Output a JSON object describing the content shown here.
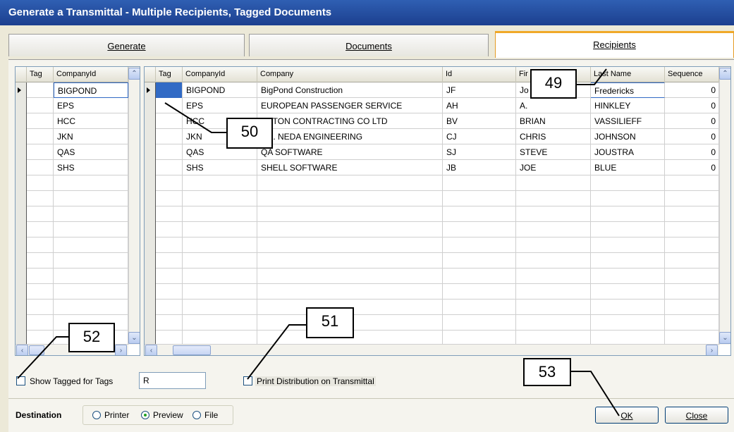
{
  "window": {
    "title": "Generate a Transmittal - Multiple Recipients, Tagged Documents"
  },
  "tabs": [
    {
      "label": "Generate"
    },
    {
      "label": "Documents"
    },
    {
      "label": "Recipients"
    }
  ],
  "left_grid": {
    "columns": [
      "Tag",
      "CompanyId"
    ],
    "rows": [
      "BIGPOND",
      "EPS",
      "HCC",
      "JKN",
      "QAS",
      "SHS"
    ]
  },
  "right_grid": {
    "columns": [
      "Tag",
      "CompanyId",
      "Company",
      "Id",
      "Fir",
      "Last Name",
      "Sequence"
    ],
    "rows": [
      {
        "companyid": "BIGPOND",
        "company": "BigPond Construction",
        "id": "JF",
        "first": "Jo",
        "last": "Fredericks",
        "seq": "0"
      },
      {
        "companyid": "EPS",
        "company": "EUROPEAN PASSENGER SERVICE",
        "id": "AH",
        "first": "A.",
        "last": "HINKLEY",
        "seq": "0"
      },
      {
        "companyid": "HCC",
        "company": "USTON CONTRACTING CO LTD",
        "id": "BV",
        "first": "BRIAN",
        "last": "VASSILIEFF",
        "seq": "0"
      },
      {
        "companyid": "JKN",
        "company": "J.K. NEDA ENGINEERING",
        "id": "CJ",
        "first": "CHRIS",
        "last": "JOHNSON",
        "seq": "0"
      },
      {
        "companyid": "QAS",
        "company": "QA SOFTWARE",
        "id": "SJ",
        "first": "STEVE",
        "last": "JOUSTRA",
        "seq": "0"
      },
      {
        "companyid": "SHS",
        "company": "SHELL SOFTWARE",
        "id": "JB",
        "first": "JOE",
        "last": "BLUE",
        "seq": "0"
      }
    ]
  },
  "callouts": {
    "c49": "49",
    "c50": "50",
    "c51": "51",
    "c52": "52",
    "c53": "53"
  },
  "options": {
    "show_tagged_label": "Show Tagged for Tags",
    "show_tagged_value": "R",
    "print_distribution_label": "Print Distribution on Transmittal"
  },
  "destination": {
    "label": "Destination",
    "options": [
      "Printer",
      "Preview",
      "File"
    ],
    "selected": "Preview"
  },
  "buttons": {
    "ok": "OK",
    "close": "Close"
  },
  "colors": {
    "title_bar": "#2f5fb3",
    "active_tab_accent": "#f0a928",
    "selected_cell": "#316ac5"
  }
}
